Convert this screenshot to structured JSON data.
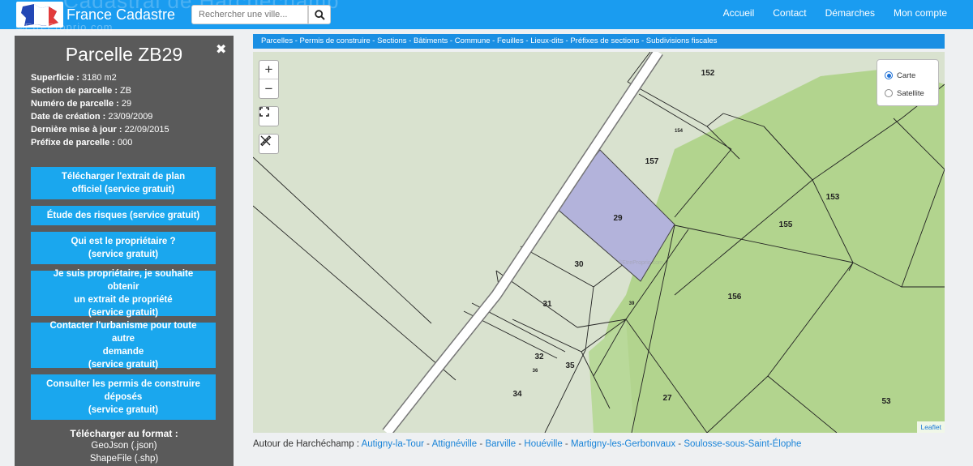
{
  "brand": {
    "name": "France Cadastre",
    "background_title": "Cadastral de Harchéchamp",
    "watermark": "©EtreProprio.com"
  },
  "search": {
    "placeholder": "Rechercher une ville..."
  },
  "nav": [
    {
      "label": "Accueil"
    },
    {
      "label": "Contact"
    },
    {
      "label": "Démarches"
    },
    {
      "label": "Mon compte"
    }
  ],
  "panel": {
    "title": "Parcelle ZB29",
    "close_glyph": "✖",
    "properties": [
      {
        "key": "Superficie :",
        "value": "3180 m2"
      },
      {
        "key": "Section de parcelle :",
        "value": "ZB"
      },
      {
        "key": "Numéro de parcelle :",
        "value": "29"
      },
      {
        "key": "Date de création :",
        "value": "23/09/2009"
      },
      {
        "key": "Dernière mise à jour :",
        "value": "22/09/2015"
      },
      {
        "key": "Préfixe de parcelle :",
        "value": "000"
      }
    ],
    "buttons": [
      {
        "lines": [
          "Télécharger l'extrait de plan",
          "officiel (service gratuit)"
        ]
      },
      {
        "lines": [
          "Étude des risques (service gratuit)"
        ]
      },
      {
        "lines": [
          "Qui est le propriétaire ?",
          "(service gratuit)"
        ]
      },
      {
        "lines": [
          "Je suis propriétaire, je souhaite obtenir",
          "un extrait de propriété",
          "(service gratuit)"
        ]
      },
      {
        "lines": [
          "Contacter l'urbanisme pour toute autre",
          "demande",
          "(service gratuit)"
        ]
      },
      {
        "lines": [
          "Consulter les permis de construire",
          "déposés",
          "(service gratuit)"
        ]
      }
    ],
    "download": {
      "title": "Télécharger au format :",
      "formats": [
        "GeoJson (.json)",
        "ShapeFile (.shp)"
      ]
    }
  },
  "layerbar": [
    "Parcelles",
    "Permis de construire",
    "Sections",
    "Bâtiments",
    "Commune",
    "Feuilles",
    "Lieux-dits",
    "Préfixes de sections",
    "Subdivisions fiscales"
  ],
  "map": {
    "zoom_in": "+",
    "zoom_out": "−",
    "basemap": [
      {
        "label": "Carte",
        "selected": true
      },
      {
        "label": "Satellite",
        "selected": false
      }
    ],
    "parcel_labels": [
      "152",
      "154",
      "157",
      "153",
      "29",
      "155",
      "30",
      "156",
      "31",
      "39",
      "32",
      "36",
      "35",
      "34",
      "27",
      "53"
    ],
    "map_watermark": "©EtreProprio.com",
    "attribution": "Leaflet",
    "selected_color": "#b3b3db",
    "field_color": "#b2d48e"
  },
  "around": {
    "prefix": "Autour de Harchéchamp :",
    "separator": "-",
    "links": [
      "Autigny-la-Tour",
      "Attignéville",
      "Barville",
      "Houéville",
      "Martigny-les-Gerbonvaux",
      "Soulosse-sous-Saint-Élophe"
    ]
  }
}
